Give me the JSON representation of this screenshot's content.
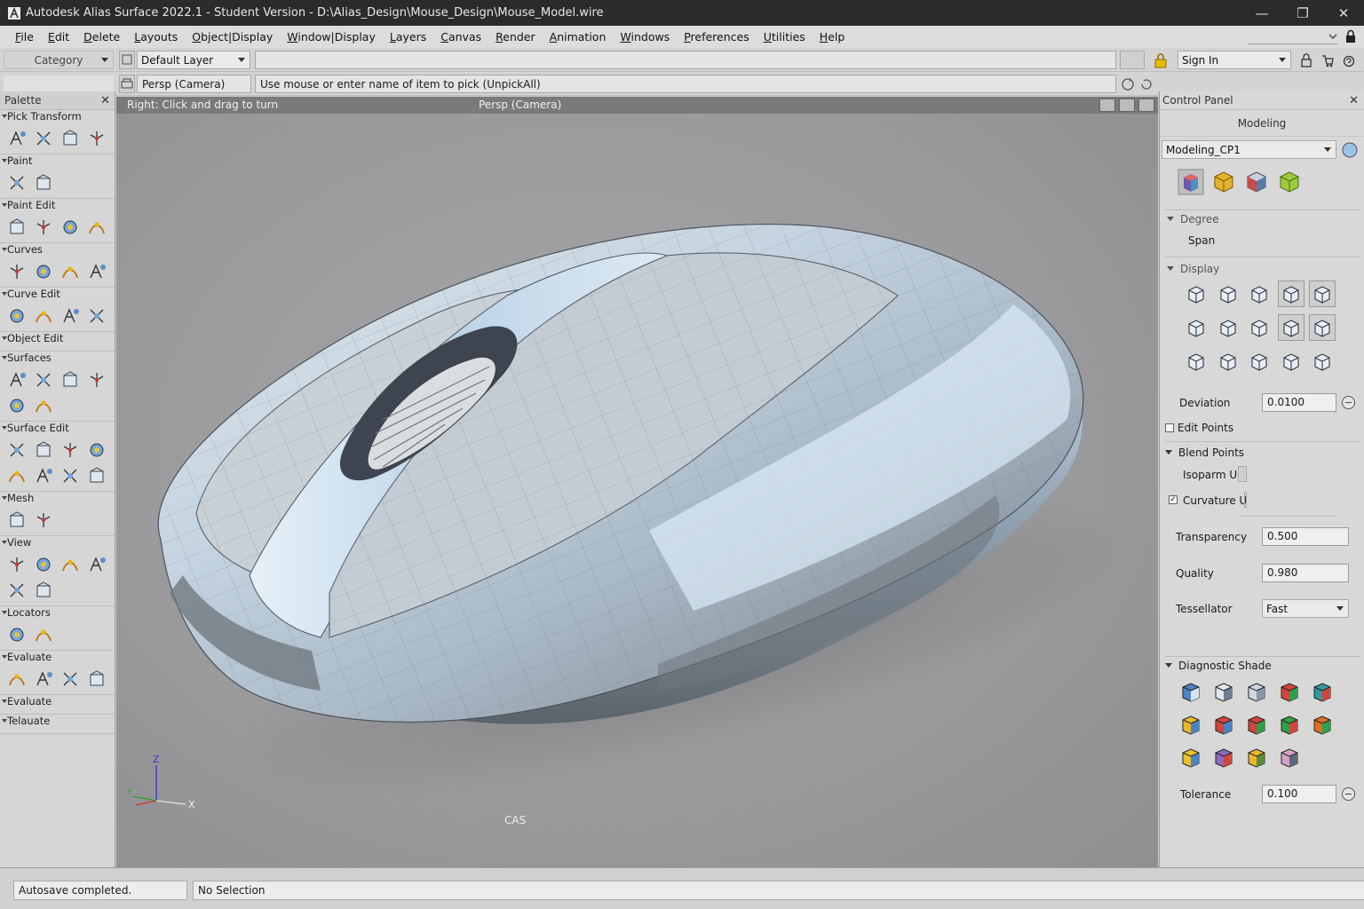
{
  "window": {
    "title": "Autodesk Alias Surface 2022.1 - Student Version - D:\\Alias_Design\\Mouse_Design\\Mouse_Model.wire",
    "controls": [
      "—",
      "❐",
      "✕"
    ]
  },
  "menu": [
    "File",
    "Edit",
    "Delete",
    "Layouts",
    "Object|Display",
    "Window|Display",
    "Layers",
    "Canvas",
    "Render",
    "Animation",
    "Windows",
    "Preferences",
    "Utilities",
    "Help"
  ],
  "toolbar": {
    "category": "Category",
    "layer": "Default Layer",
    "sign_in": "Sign In",
    "camera": "Persp (Camera)",
    "prompt": "Use mouse or enter name of item to pick (UnpickAll)"
  },
  "palette": {
    "title": "Palette",
    "close": "✕",
    "sections": [
      {
        "label": "Pick   Transform",
        "icons": 4
      },
      {
        "label": "Paint",
        "icons": 2
      },
      {
        "label": "Paint Edit",
        "icons": 4
      },
      {
        "label": "Curves",
        "icons": 4
      },
      {
        "label": "Curve Edit",
        "icons": 4
      },
      {
        "label": "Object Edit",
        "icons": 0
      },
      {
        "label": "Surfaces",
        "icons": 6
      },
      {
        "label": "Surface Edit",
        "icons": 8
      },
      {
        "label": "Mesh",
        "icons": 2
      },
      {
        "label": "View",
        "icons": 6
      },
      {
        "label": "Locators",
        "icons": 2
      },
      {
        "label": "Evaluate",
        "icons": 4
      },
      {
        "label": "Evaluate",
        "icons": 0
      },
      {
        "label": "Telauate",
        "icons": 0
      }
    ]
  },
  "viewport": {
    "hint": "Right: Click and drag to turn",
    "camera": "Persp (Camera)",
    "footer": "CAS",
    "axis": {
      "z": "Z",
      "x": "X",
      "y": "Y"
    }
  },
  "control_panel": {
    "title": "Control Panel",
    "close": "✕",
    "tab": "Modeling",
    "preset": "Modeling_CP1",
    "degree": "Degree",
    "span": "Span",
    "display": "Display",
    "deviation_label": "Deviation",
    "deviation": "0.0100",
    "edit_points": "Edit Points",
    "blend_points": "Blend Points",
    "isoparm": "Isoparm U",
    "curvature": "Curvature U",
    "curvature_checked": "✓",
    "transparency_label": "Transparency",
    "transparency": "0.500",
    "quality_label": "Quality",
    "quality": "0.980",
    "tessellator_label": "Tessellator",
    "tessellator": "Fast",
    "diagnostic": "Diagnostic Shade",
    "tolerance_label": "Tolerance",
    "tolerance": "0.100"
  },
  "status": {
    "left": "Autosave completed.",
    "right": "No Selection"
  },
  "colors": {
    "titlebar": "#2b2b2b",
    "viewport_bg": "#9d9d9f",
    "model_highlight": "#c9dff0",
    "axis_z": "#3a3ad6",
    "axis_x": "#d23030",
    "axis_y": "#2aa02a"
  }
}
